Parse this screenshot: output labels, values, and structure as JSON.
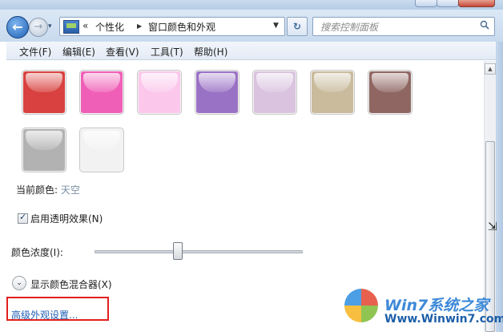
{
  "window": {
    "back_glyph": "←",
    "forward_glyph": "→",
    "history_glyph": "▾",
    "breadcrumb_sep": "«",
    "crumbs": [
      "个性化",
      "窗口颜色和外观"
    ],
    "crumb_arrow": "▶",
    "dropdown_glyph": "▼",
    "refresh_glyph": "↻",
    "search_placeholder": "搜索控制面板"
  },
  "menu": {
    "items": [
      "文件(F)",
      "编辑(E)",
      "查看(V)",
      "工具(T)",
      "帮助(H)"
    ]
  },
  "swatches": {
    "colors": [
      "#d8413f",
      "#f05fb7",
      "#fbc8ec",
      "#9a72c5",
      "#d9c3df",
      "#c9bb9c",
      "#8f6662",
      "#b2b2b2",
      "#f2f2f2"
    ]
  },
  "current_color": {
    "label": "当前颜色:",
    "value": "天空"
  },
  "transparency": {
    "label": "启用透明效果(N)",
    "checked": true
  },
  "intensity": {
    "label": "颜色浓度(I):",
    "level_fraction": 0.4
  },
  "mixer": {
    "glyph": "⌄",
    "label": "显示颜色混合器(X)"
  },
  "advanced_link": {
    "label": "高级外观设置..."
  },
  "watermark": {
    "title": "Win7系统之家",
    "url": "Www.Winwin7.com"
  },
  "colors": {
    "link": "#1f5fb5",
    "highlight": "#e21f1f",
    "accent": "#1f5fb5"
  }
}
